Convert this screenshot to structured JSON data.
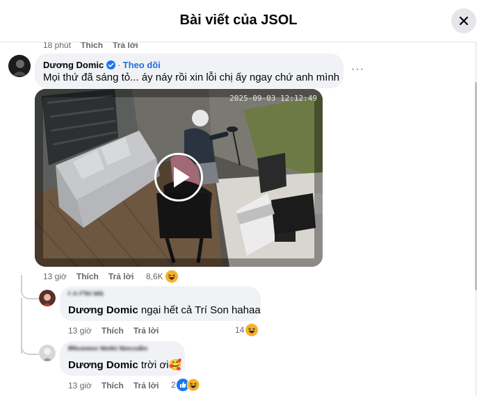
{
  "header": {
    "title": "Bài viết của JSOL"
  },
  "top_meta": {
    "time": "18 phút",
    "like": "Thích",
    "reply": "Trả lời"
  },
  "comment": {
    "author": "Dương Domic",
    "follow": "Theo dõi",
    "text": "Mọi thứ đã sáng tỏ... áy náy rồi xin lỗi chị ấy ngay chứ anh mình",
    "more": "···",
    "video": {
      "timestamp": "2025-09-03 12:12:49"
    },
    "meta": {
      "time": "13 giờ",
      "like": "Thích",
      "reply": "Trả lời",
      "reaction_count": "8,6K"
    }
  },
  "replies": [
    {
      "author": "Lý Chi Hà",
      "mention": "Dương Domic",
      "text": " ngại hết cả Trí Son hahaa",
      "meta": {
        "time": "13 giờ",
        "like": "Thích",
        "reply": "Trả lời",
        "reaction_count": "14"
      }
    },
    {
      "author": "Phương Nghi Nguyễn",
      "mention": "Dương Domic",
      "text": " trời ơi🥰",
      "meta": {
        "time": "13 giờ",
        "like": "Thích",
        "reply": "Trả lời",
        "reaction_count": "2"
      }
    }
  ],
  "icons": {
    "close": "close-icon",
    "verified": "verified-badge-icon",
    "play": "play-icon",
    "haha": "haha-reaction-icon",
    "like": "like-reaction-icon"
  },
  "colors": {
    "link": "#216fdb",
    "text": "#050505",
    "muted": "#65676b",
    "bubble": "#f0f2f5"
  }
}
